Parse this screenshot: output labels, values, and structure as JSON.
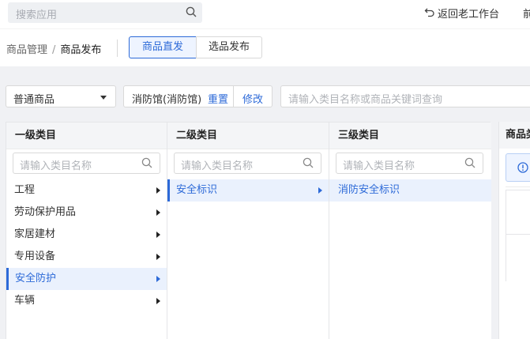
{
  "topbar": {
    "search_placeholder": "搜索应用",
    "back_label": "返回老工作台",
    "cut_text": "前"
  },
  "breadcrumb": {
    "parent": "商品管理",
    "separator": "/",
    "current": "商品发布"
  },
  "tabs": [
    {
      "label": "商品直发",
      "active": true
    },
    {
      "label": "选品发布",
      "active": false
    }
  ],
  "filters": {
    "product_type": "普通商品",
    "shop_name": "消防馆(消防馆)",
    "reset_label": "重置",
    "edit_label": "修改",
    "keyword_placeholder": "请输入类目名称或商品关键词查询"
  },
  "columns": [
    {
      "title": "一级类目",
      "search_placeholder": "请输入类目名称",
      "items": [
        {
          "label": "工程",
          "active": false
        },
        {
          "label": "劳动保护用品",
          "active": false
        },
        {
          "label": "家居建材",
          "active": false
        },
        {
          "label": "专用设备",
          "active": false
        },
        {
          "label": "安全防护",
          "active": true
        },
        {
          "label": "车辆",
          "active": false
        }
      ]
    },
    {
      "title": "二级类目",
      "search_placeholder": "请输入类目名称",
      "items": [
        {
          "label": "安全标识",
          "active": true
        }
      ]
    },
    {
      "title": "三级类目",
      "search_placeholder": "请输入类目名称",
      "items": [
        {
          "label": "消防安全标识",
          "active": true
        }
      ]
    }
  ],
  "right_panel": {
    "title_cut": "商品类"
  },
  "colors": {
    "accent": "#2d6ad8",
    "accent_bg": "#eaf1fd",
    "page_bg": "#f0f1f4"
  }
}
